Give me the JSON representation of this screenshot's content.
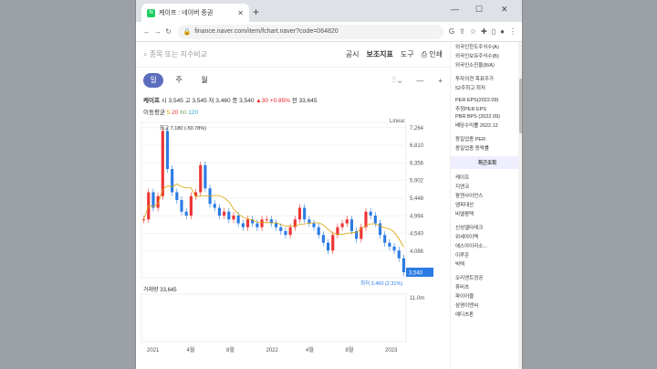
{
  "browser": {
    "tab_title": "케이프 : 네이버 증권",
    "url": "finance.naver.com/item/fchart.naver?code=064820"
  },
  "toolbar": {
    "search_placeholder": "종목 또는 지수비교",
    "menu": [
      "공시",
      "보조지표",
      "도구",
      "인쇄"
    ]
  },
  "periods": [
    "일",
    "주",
    "월"
  ],
  "quote": {
    "name": "케이프",
    "open": "시 3,545",
    "high": "고 3,545",
    "low": "저 3,460",
    "close": "종 3,540",
    "change": "▲30 +0.85%",
    "prev": "전 33,645"
  },
  "moving_avg": {
    "label": "이동평균",
    "p5": "5",
    "p20": "20",
    "p60": "60",
    "p120": "120"
  },
  "chart_data": {
    "type": "candlestick",
    "scale": "Linear",
    "yticks": [
      7264,
      6810,
      6356,
      5902,
      5448,
      4994,
      4540,
      4086
    ],
    "xticks": [
      "2021",
      "4월",
      "8월",
      "2022",
      "4월",
      "8월",
      "2023"
    ],
    "max_label": "최고 7,180 (-50.78%)",
    "min_label": "최저 3,460 (2.31%)",
    "last_price": "3,540",
    "volume_label": "거래량 33,645",
    "volume_tick": "11.0m",
    "ylim": [
      3400,
      7400
    ],
    "closes": [
      4900,
      5600,
      5200,
      5500,
      7180,
      6200,
      5600,
      5400,
      5100,
      5000,
      5500,
      5600,
      6300,
      5700,
      5300,
      5200,
      5000,
      5100,
      4900,
      5000,
      4800,
      4700,
      4900,
      4800,
      4700,
      4900,
      4900,
      4800,
      4700,
      4600,
      4500,
      4700,
      4900,
      5200,
      4900,
      4800,
      4700,
      4500,
      4300,
      4100,
      4500,
      4700,
      4800,
      4900,
      4600,
      4400,
      4700,
      5100,
      5000,
      4800,
      4500,
      4300,
      4200,
      4100,
      3900,
      3540
    ]
  },
  "side": {
    "items_top": [
      "외국인한도주식수(A)",
      "외국인보유주식수(B)",
      "외국인소진율(B/A)",
      "",
      "투자의견 목표주가",
      "52주최고 최저",
      "",
      "PER EPS(2022.09)",
      "추정PER EPS",
      "PBR BPS (2022.09)",
      "배당수익률 2022.12",
      "",
      "동일업종 PER",
      "동일업종 등락률"
    ],
    "recent_header": "최근조회",
    "recent": [
      "케이프",
      "지엔코",
      "팜젠사이언스",
      "엠피대산",
      "비엘팜텍",
      "",
      "신성델타테크",
      "위세아이텍",
      "에스아이리소...",
      "이루온",
      "빅텍",
      "",
      "오리엔트정공",
      "휴비츠",
      "파이어블",
      "삼영이엔씨",
      "에디츠톤"
    ]
  }
}
